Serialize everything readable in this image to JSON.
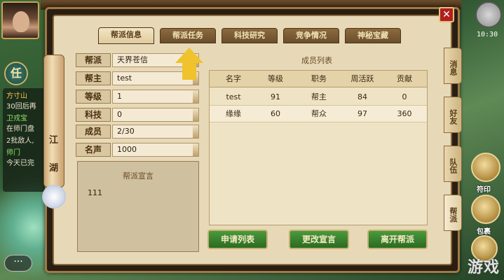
{
  "hud": {
    "task_button": "任",
    "quests": [
      {
        "title": "方寸山",
        "detail": "30回后再"
      },
      {
        "title": "卫戎宝",
        "detail": "在师门盘"
      },
      {
        "title": "",
        "detail": "2批敌人,"
      },
      {
        "title": "师门",
        "detail": "今天已完"
      }
    ],
    "chat_button": "···",
    "clock": "10:30",
    "side_labels": [
      "符印",
      "包裹"
    ],
    "watermark": "游戏"
  },
  "window": {
    "scroll_text": [
      "江",
      "湖"
    ],
    "close_label": "✕",
    "tabs": [
      {
        "label": "帮派信息",
        "active": true
      },
      {
        "label": "帮派任务",
        "active": false
      },
      {
        "label": "科技研究",
        "active": false
      },
      {
        "label": "竞争情况",
        "active": false
      },
      {
        "label": "神秘宝藏",
        "active": false
      }
    ],
    "info": [
      {
        "label": "帮派",
        "value": "天界苍信"
      },
      {
        "label": "帮主",
        "value": "test"
      },
      {
        "label": "等级",
        "value": "1"
      },
      {
        "label": "科技",
        "value": "0"
      },
      {
        "label": "成员",
        "value": "2/30"
      },
      {
        "label": "名声",
        "value": "1000"
      }
    ],
    "declaration": {
      "title": "帮派宣言",
      "text": "111"
    },
    "member_list": {
      "title": "成员列表",
      "columns": [
        "名字",
        "等级",
        "职务",
        "周活跃",
        "贡献"
      ],
      "rows": [
        [
          "test",
          "91",
          "帮主",
          "84",
          "0"
        ],
        [
          "缘缘",
          "60",
          "帮众",
          "97",
          "360"
        ]
      ]
    },
    "buttons": {
      "apply_list": "申请列表",
      "change_declaration": "更改宣言",
      "leave_guild": "离开帮派"
    },
    "side_tabs": [
      "消息",
      "好友",
      "队伍",
      "帮派"
    ]
  },
  "colors": {
    "panel_bg": "#e7d9b8",
    "button_green": "#2b6a22",
    "arrow": "#f0c22c"
  }
}
